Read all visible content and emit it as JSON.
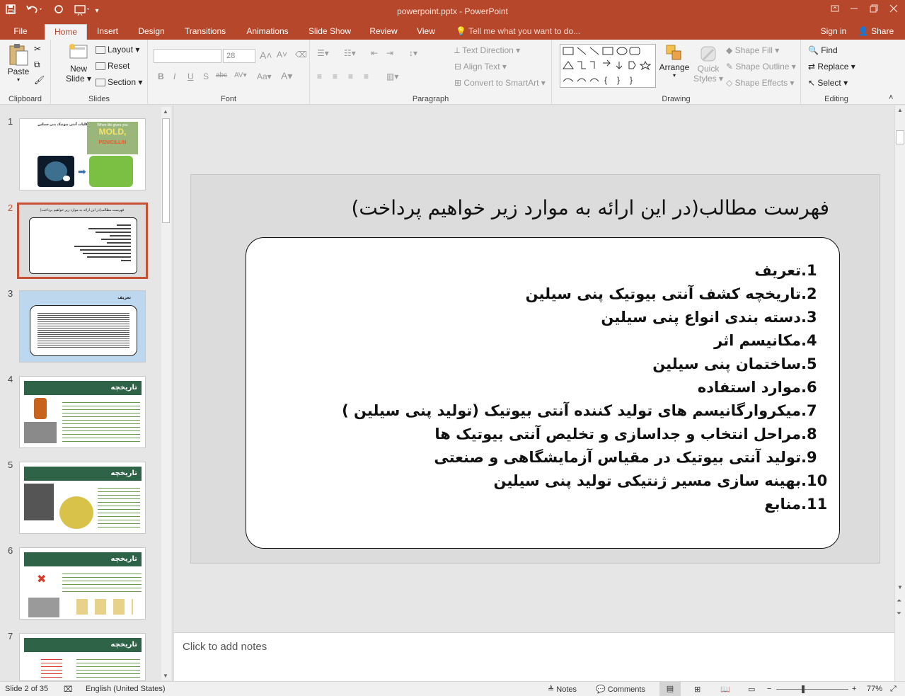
{
  "app": {
    "doc_title": "powerpoint.pptx - PowerPoint"
  },
  "tabs": [
    "File",
    "Home",
    "Insert",
    "Design",
    "Transitions",
    "Animations",
    "Slide Show",
    "Review",
    "View"
  ],
  "tell_me": "Tell me what you want to do...",
  "sign_in": "Sign in",
  "share": "Share",
  "ribbon": {
    "clipboard": {
      "label": "Clipboard",
      "paste": "Paste"
    },
    "slides": {
      "label": "Slides",
      "new_slide_1": "New",
      "new_slide_2": "Slide",
      "layout": "Layout",
      "reset": "Reset",
      "section": "Section"
    },
    "font": {
      "label": "Font",
      "size": "28"
    },
    "paragraph": {
      "label": "Paragraph",
      "text_direction": "Text Direction",
      "align_text": "Align Text",
      "convert": "Convert to SmartArt"
    },
    "drawing": {
      "label": "Drawing",
      "arrange": "Arrange",
      "quick_styles_1": "Quick",
      "quick_styles_2": "Styles",
      "shape_fill": "Shape Fill",
      "shape_outline": "Shape Outline",
      "shape_effects": "Shape Effects"
    },
    "editing": {
      "label": "Editing",
      "find": "Find",
      "replace": "Replace",
      "select": "Select"
    }
  },
  "thumbnails": {
    "numbers": [
      "1",
      "2",
      "3",
      "4",
      "5",
      "6",
      "7"
    ],
    "t1_title": "کلیات آنتی بیوتیک پنی سیلین",
    "t1_mold": "MOLD,",
    "t1_pen": "PENICILLIN",
    "t1_when": "When life gives you",
    "t2_title": "فهرست مطالب(در این ارائه به موارد زیر خواهیم پرداخت)",
    "t3_title": "تعریف",
    "t4_title": "تاریخچه",
    "t5_title": "تاریخچه",
    "t6_title": "تاریخچه",
    "t7_title": "تاریخچه"
  },
  "slide": {
    "title": "فهرست مطالب(در این ارائه به موارد زیر خواهیم پرداخت)",
    "items": [
      {
        "num": "1.",
        "text": "تعریف"
      },
      {
        "num": "2.",
        "text": "تاریخچه کشف آنتی بیوتیک پنی سیلین"
      },
      {
        "num": "3.",
        "text": "دسته بندی انواع پنی سیلین"
      },
      {
        "num": "4.",
        "text": "مکانیسم اثر"
      },
      {
        "num": "5.",
        "text": "ساختمان پنی سیلین"
      },
      {
        "num": "6.",
        "text": "موارد استفاده"
      },
      {
        "num": "7.",
        "text": "میکروارگانیسم های تولید کننده آنتی بیوتیک (تولید پنی سیلین )"
      },
      {
        "num": "8.",
        "text": "مراحل انتخاب و جداسازی و تخلیص آنتی بیوتیک ها"
      },
      {
        "num": "9.",
        "text": "تولید آنتی بیوتیک در مقیاس آزمایشگاهی و صنعتی"
      },
      {
        "num": "10.",
        "text": "بهینه سازی مسیر ژنتیکی  تولید پنی سیلین"
      },
      {
        "num": "11.",
        "text": "منابع"
      }
    ]
  },
  "notes_placeholder": "Click to add notes",
  "status": {
    "slide_of": "Slide 2 of 35",
    "language": "English (United States)",
    "notes": "Notes",
    "comments": "Comments",
    "zoom": "77%"
  },
  "colors": {
    "accent": "#b7472a",
    "selected_thumb": "#c75136",
    "thumb_header": "#2f6348"
  }
}
